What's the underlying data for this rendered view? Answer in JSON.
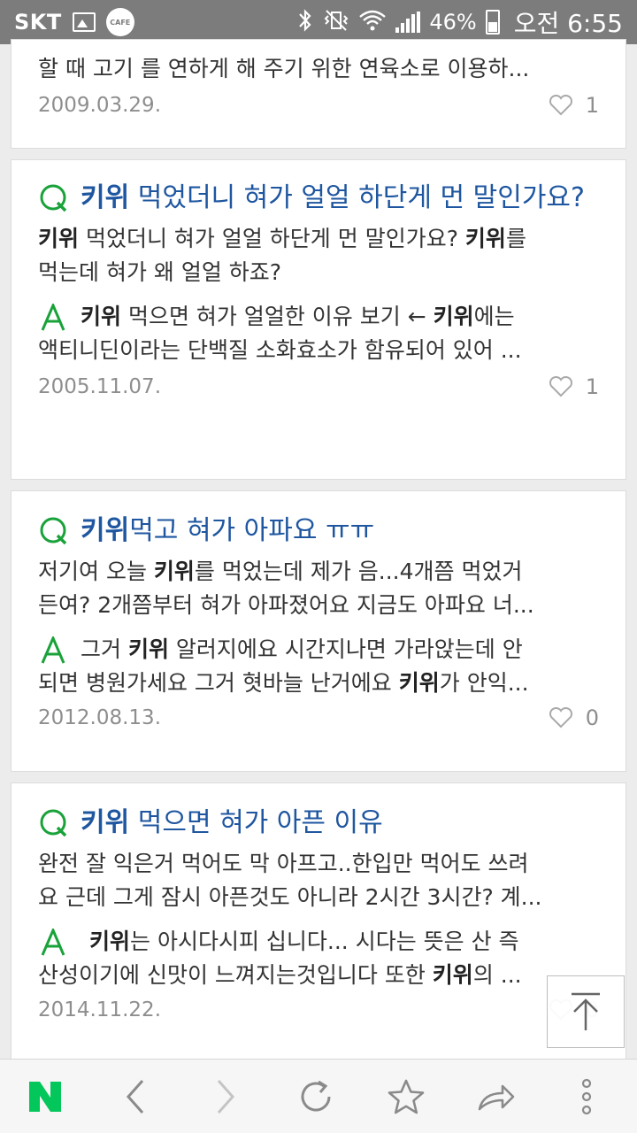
{
  "status_bar": {
    "carrier": "SKT",
    "cafe": "CAFE",
    "battery": "46%",
    "time": "오전 6:55"
  },
  "cards": [
    {
      "top_text": "할 때 고기 를 연하게 해 주기 위한 연육소로 이용하...",
      "date": "2009.03.29.",
      "likes": "1"
    },
    {
      "q_kw": "키위",
      "q_rest": " 먹었더니 혀가 얼얼 하단게 먼 말인가요?",
      "b1_kw": "키위",
      "b1_mid": " 먹었더니 혀가 얼얼 하단게 먼 말인가요? ",
      "b1_kw2": "키위",
      "b1_rest": "를",
      "b2": "먹는데 혀가 왜 얼얼 하죠?",
      "a1_kw": "키위",
      "a1_mid": " 먹으면 혀가 얼얼한 이유 보기 ← ",
      "a1_kw2": "키위",
      "a1_rest": "에는",
      "a2": "액티니딘이라는 단백질 소화효소가 함유되어 있어 ...",
      "date": "2005.11.07.",
      "likes": "1"
    },
    {
      "q_kw": "키위",
      "q_rest": "먹고 혀가 아파요 ㅠㅠ",
      "b1_pre": "저기여 오늘 ",
      "b1_kw": "키위",
      "b1_rest": "를 먹었는데 제가 음...4개쯤 먹었거",
      "b2": "든여? 2개쯤부터 혀가 아파졌어요 지금도 아파요 너...",
      "a1_pre": "그거 ",
      "a1_kw": "키위",
      "a1_rest": " 알러지에요 시간지나면 가라앉는데 안",
      "a2_pre": "되면 병원가세요 그거 혓바늘 난거에요 ",
      "a2_kw": "키위",
      "a2_rest": "가 안익...",
      "date": "2012.08.13.",
      "likes": "0"
    },
    {
      "q_kw": "키위",
      "q_rest": " 먹으면 혀가 아픈 이유",
      "b1": "완전 잘 익은거 먹어도 막 아프고..한입만 먹어도 쓰려",
      "b2": "요 근데 그게 잠시 아픈것도 아니라 2시간 3시간? 계...",
      "a1_kw": "키위",
      "a1_rest": "는 아시다시피 십니다... 시다는 뜻은 산 즉",
      "a2_pre": "산성이기에 신맛이 느껴지는것입니다 또한 ",
      "a2_kw": "키위",
      "a2_rest": "의 ...",
      "date": "2014.11.22.",
      "likes": "0"
    }
  ],
  "toolbar": {
    "naver_color": "#03c75a",
    "icon_color": "#8a8a8a"
  }
}
